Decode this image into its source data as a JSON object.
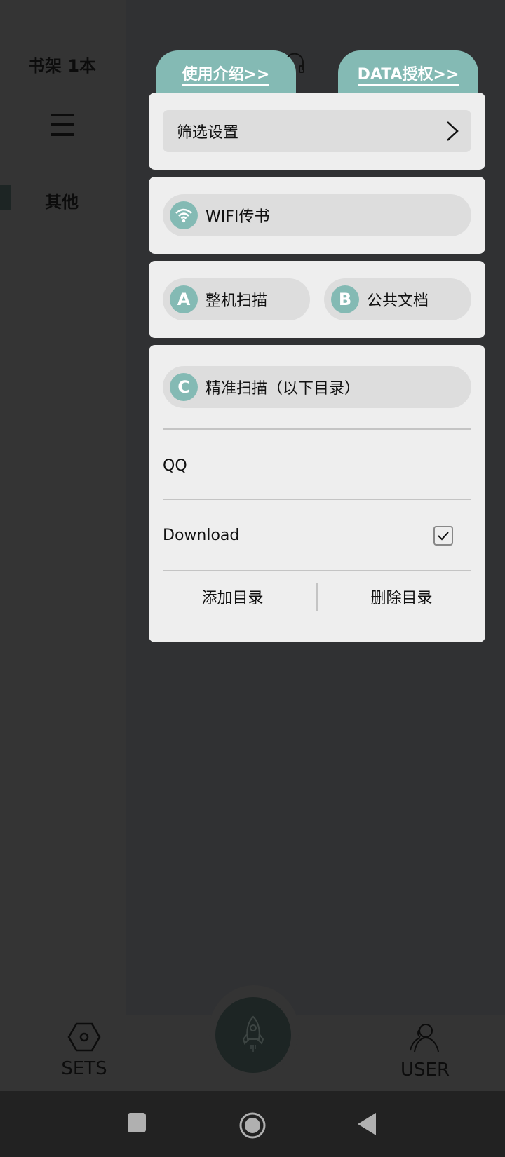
{
  "sidebar": {
    "shelf_title": "书架 1本",
    "menu_icon": "hamburger-menu-icon",
    "categories": [
      {
        "label": "其他",
        "selected": true
      }
    ]
  },
  "top_tabs": [
    {
      "label": "使用介绍>>"
    },
    {
      "label": "DATA授权>>"
    }
  ],
  "popup": {
    "filter_settings": {
      "label": "筛选设置",
      "icon": "chevron-right-icon"
    },
    "wifi_transfer": {
      "label": "WIFI传书",
      "icon": "wifi-icon"
    },
    "scan_options": [
      {
        "badge": "A",
        "label": "整机扫描"
      },
      {
        "badge": "B",
        "label": "公共文档"
      }
    ],
    "precise_scan": {
      "badge": "C",
      "label": "精准扫描（以下目录）"
    },
    "directories": [
      {
        "name": "QQ",
        "checked": false
      },
      {
        "name": "Download",
        "checked": true
      }
    ],
    "actions": {
      "add": "添加目录",
      "delete": "删除目录"
    }
  },
  "bottom_nav": {
    "sets_label": "SETS",
    "user_label": "USER",
    "center_icon": "rocket-icon"
  },
  "colors": {
    "accent": "#84bab4",
    "card_bg": "#eeeeee",
    "pill_bg": "#dddddd",
    "background": "#333333"
  }
}
